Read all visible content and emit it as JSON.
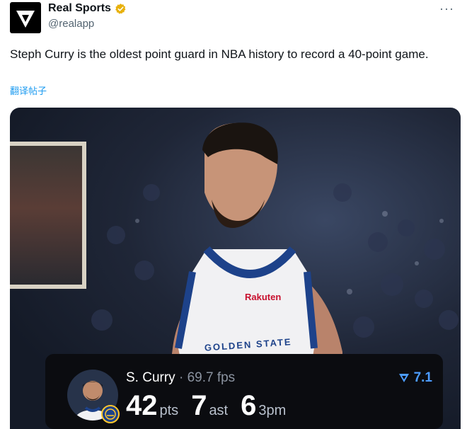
{
  "account": {
    "display_name": "Real Sports",
    "handle": "@realapp",
    "avatar_icon": "real-sports-logo-icon",
    "verified_icon": "gold-verified-badge-icon",
    "verified_color": "#e8b10d"
  },
  "more_label": "···",
  "tweet": {
    "text": "Steph Curry is the oldest point guard in NBA history to record a 40-point game.",
    "translate_label": "翻译帖子"
  },
  "media": {
    "jersey_sponsor": "Rakuten",
    "jersey_team": "GOLDEN STATE",
    "scorecard": {
      "player_name": "S. Curry",
      "separator": " · ",
      "rating_text": "69.7 fps",
      "score_icon": "real-sports-flag-icon",
      "score_value": "7.1",
      "stats": [
        {
          "value": "42",
          "unit": "pts"
        },
        {
          "value": "7",
          "unit": "ast"
        },
        {
          "value": "6",
          "unit": "3pm"
        }
      ],
      "team_badge_icon": "warriors-logo-icon"
    }
  },
  "colors": {
    "link": "#1d9bf0",
    "muted": "#536471",
    "accent_blue": "#4c9cff",
    "warriors_blue": "#1d428a",
    "warriors_gold": "#ffc72c"
  }
}
